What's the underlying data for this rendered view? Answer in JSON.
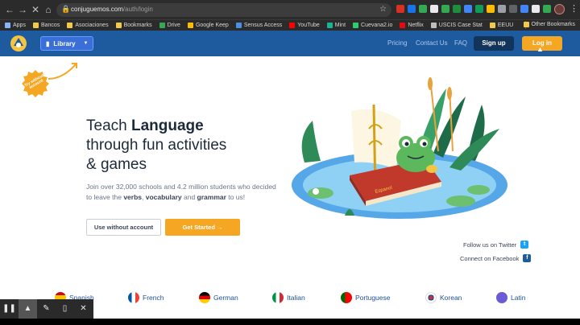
{
  "browser": {
    "url_host": "conjuguemos.com",
    "url_path": "/auth/login",
    "bookmarks": [
      {
        "label": "Apps",
        "color": "#8ab4f8"
      },
      {
        "label": "Bancos",
        "color": "#f2c94c"
      },
      {
        "label": "Asociaciones",
        "color": "#f2c94c"
      },
      {
        "label": "Bookmarks",
        "color": "#f2c94c"
      },
      {
        "label": "Drive",
        "color": "#34a853"
      },
      {
        "label": "Google Keep",
        "color": "#fbbc04"
      },
      {
        "label": "Sensus Access",
        "color": "#4a90e2"
      },
      {
        "label": "YouTube",
        "color": "#ff0000"
      },
      {
        "label": "Mint",
        "color": "#1ab394"
      },
      {
        "label": "Cuevana2.io",
        "color": "#2ecc71"
      },
      {
        "label": "Netflix",
        "color": "#e50914"
      },
      {
        "label": "USCIS Case Stat",
        "color": "#bdbdbd"
      },
      {
        "label": "EEUU",
        "color": "#f2c94c"
      }
    ],
    "other_bookmarks": "Other Bookmarks"
  },
  "header": {
    "library_label": "Library",
    "pricing": "Pricing",
    "contact": "Contact Us",
    "faq": "FAQ",
    "signup": "Sign up",
    "login": "Log in"
  },
  "hero": {
    "badge_text": "Try without account",
    "title_line1_prefix": "Teach ",
    "title_line1_bold": "Language",
    "title_line2": "through fun activities",
    "title_line3": "& games",
    "desc_part1": "Join over 32,000 schools and 4.2 million students who decided to leave the ",
    "desc_bold1": "verbs",
    "desc_part2": ", ",
    "desc_bold2": "vocabulary",
    "desc_part3": " and ",
    "desc_bold3": "grammar",
    "desc_part4": " to us!",
    "use_without": "Use without account",
    "get_started": "Get Started",
    "book_label": "Espanol"
  },
  "social": {
    "twitter": "Follow us on Twitter",
    "facebook": "Connect on Facebook"
  },
  "languages": [
    {
      "name": "Spanish"
    },
    {
      "name": "French"
    },
    {
      "name": "German"
    },
    {
      "name": "Italian"
    },
    {
      "name": "Portuguese"
    },
    {
      "name": "Korean"
    },
    {
      "name": "Latin"
    }
  ],
  "colors": {
    "header_blue": "#1e5b9e",
    "accent_orange": "#f5a623",
    "library_blue": "#3a6fd8",
    "signup_navy": "#12335a"
  }
}
